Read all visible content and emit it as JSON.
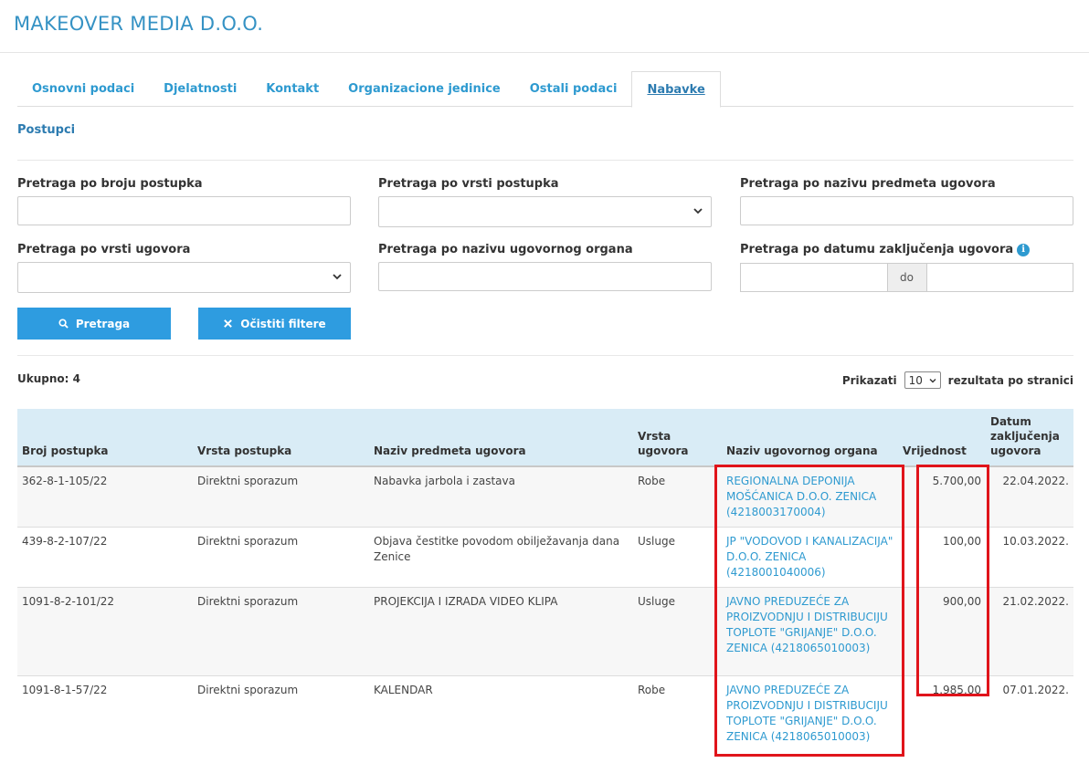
{
  "company": {
    "title": "MAKEOVER MEDIA D.O.O."
  },
  "tabs": [
    {
      "label": "Osnovni podaci"
    },
    {
      "label": "Djelatnosti"
    },
    {
      "label": "Kontakt"
    },
    {
      "label": "Organizacione jedinice"
    },
    {
      "label": "Ostali podaci"
    },
    {
      "label": "Nabavke",
      "active": true
    }
  ],
  "section": {
    "heading": "Postupci"
  },
  "filters": {
    "broj_postupka": {
      "label": "Pretraga po broju postupka",
      "value": ""
    },
    "vrsta_postupka": {
      "label": "Pretraga po vrsti postupka",
      "value": ""
    },
    "naziv_predmeta": {
      "label": "Pretraga po nazivu predmeta ugovora",
      "value": ""
    },
    "vrsta_ugovora": {
      "label": "Pretraga po vrsti ugovora",
      "value": ""
    },
    "naziv_organa": {
      "label": "Pretraga po nazivu ugovornog organa",
      "value": ""
    },
    "datum": {
      "label": "Pretraga po datumu zaključenja ugovora",
      "separator": "do",
      "from": "",
      "to": ""
    }
  },
  "buttons": {
    "search": "Pretraga",
    "clear": "Očistiti filtere"
  },
  "results": {
    "total": "Ukupno: 4",
    "show_label": "Prikazati",
    "per_page": "10",
    "per_page_suffix": "rezultata po stranici"
  },
  "table": {
    "headers": {
      "broj": "Broj postupka",
      "vrsta_postupka": "Vrsta postupka",
      "predmet": "Naziv predmeta ugovora",
      "vrsta_ugovora": "Vrsta ugovora",
      "organ": "Naziv ugovornog organa",
      "vrijednost": "Vrijednost",
      "datum": "Datum zaključenja ugovora"
    },
    "rows": [
      {
        "broj": "362-8-1-105/22",
        "vrsta_postupka": "Direktni sporazum",
        "predmet": "Nabavka jarbola i zastava",
        "vrsta_ugovora": "Robe",
        "organ": "REGIONALNA DEPONIJA MOŠĆANICA D.O.O. ZENICA (4218003170004)",
        "vrijednost": "5.700,00",
        "datum": "22.04.2022."
      },
      {
        "broj": "439-8-2-107/22",
        "vrsta_postupka": "Direktni sporazum",
        "predmet": "Objava čestitke povodom obilježavanja dana Zenice",
        "vrsta_ugovora": "Usluge",
        "organ": "JP \"VODOVOD I KANALIZACIJA\" D.O.O. ZENICA (4218001040006)",
        "vrijednost": "100,00",
        "datum": "10.03.2022."
      },
      {
        "broj": "1091-8-2-101/22",
        "vrsta_postupka": "Direktni sporazum",
        "predmet": "PROJEKCIJA I IZRADA VIDEO KLIPA",
        "vrsta_ugovora": "Usluge",
        "organ": "JAVNO PREDUZEĆE ZA PROIZVODNJU I DISTRIBUCIJU TOPLOTE \"GRIJANJE\" D.O.O. ZENICA (4218065010003)",
        "vrijednost": "900,00",
        "datum": "21.02.2022."
      },
      {
        "broj": "1091-8-1-57/22",
        "vrsta_postupka": "Direktni sporazum",
        "predmet": "KALENDAR",
        "vrsta_ugovora": "Robe",
        "organ": "JAVNO PREDUZEĆE ZA PROIZVODNJU I DISTRIBUCIJU TOPLOTE \"GRIJANJE\" D.O.O. ZENICA (4218065010003)",
        "vrijednost": "1.985,00",
        "datum": "07.01.2022."
      }
    ]
  },
  "colors": {
    "accent": "#2e9ad0",
    "button": "#2e9ce0",
    "header_bg": "#d9ecf6",
    "highlight": "#e0141b"
  },
  "icons": {
    "search": "search-icon",
    "clear": "close-icon",
    "info": "info-icon",
    "dropdown": "chevron-down-icon"
  }
}
